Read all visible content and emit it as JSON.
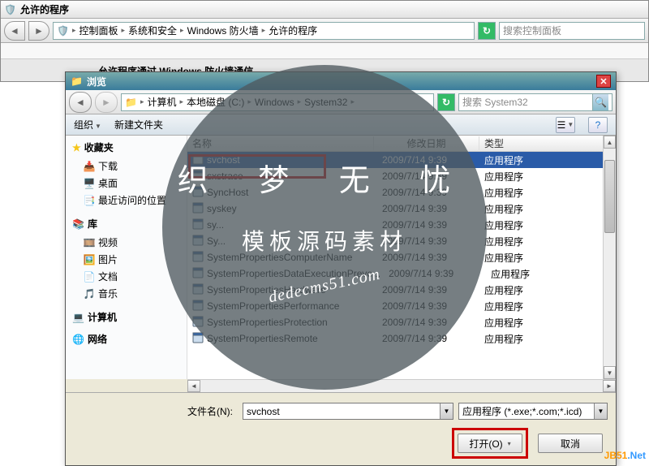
{
  "outer_window": {
    "title": "允许的程序",
    "breadcrumb": [
      "控制面板",
      "系统和安全",
      "Windows 防火墙",
      "允许的程序"
    ],
    "search_placeholder": "搜索控制面板",
    "subtitle": "允许程序通过 Windows 防火墙通信"
  },
  "dialog": {
    "title": "浏览",
    "breadcrumb": [
      "计算机",
      "本地磁盘 (C:)",
      "Windows",
      "System32"
    ],
    "search_placeholder": "搜索 System32",
    "toolbar": {
      "organize": "组织",
      "new_folder": "新建文件夹"
    },
    "sidebar": {
      "favorites": {
        "label": "收藏夹",
        "items": [
          "下载",
          "桌面",
          "最近访问的位置"
        ]
      },
      "libraries": {
        "label": "库",
        "items": [
          "视频",
          "图片",
          "文档",
          "音乐"
        ]
      },
      "computer": "计算机",
      "network": "网络"
    },
    "columns": {
      "name": "名称",
      "date": "修改日期",
      "type": "类型"
    },
    "files": [
      {
        "name": "svchost",
        "date": "2009/7/14 9:39",
        "type": "应用程序",
        "selected": true
      },
      {
        "name": "sxstrace",
        "date": "2009/7/14 9:39",
        "type": "应用程序"
      },
      {
        "name": "SyncHost",
        "date": "2009/7/14 9:39",
        "type": "应用程序"
      },
      {
        "name": "syskey",
        "date": "2009/7/14 9:39",
        "type": "应用程序"
      },
      {
        "name": "sy...",
        "date": "2009/7/14 9:39",
        "type": "应用程序"
      },
      {
        "name": "Sy...",
        "date": "2009/7/14 9:39",
        "type": "应用程序"
      },
      {
        "name": "SystemPropertiesComputerName",
        "date": "2009/7/14 9:39",
        "type": "应用程序"
      },
      {
        "name": "SystemPropertiesDataExecutionPreve...",
        "date": "2009/7/14 9:39",
        "type": "应用程序"
      },
      {
        "name": "SystemPropertiesHardware",
        "date": "2009/7/14 9:39",
        "type": "应用程序"
      },
      {
        "name": "SystemPropertiesPerformance",
        "date": "2009/7/14 9:39",
        "type": "应用程序"
      },
      {
        "name": "SystemPropertiesProtection",
        "date": "2009/7/14 9:39",
        "type": "应用程序"
      },
      {
        "name": "SystemPropertiesRemote",
        "date": "2009/7/14 9:39",
        "type": "应用程序"
      }
    ],
    "filename_label": "文件名(N):",
    "filename_value": "svchost",
    "filter_value": "应用程序 (*.exe;*.com;*.icd)",
    "open_btn": "打开(O)",
    "cancel_btn": "取消"
  },
  "watermark": {
    "line1": "织 梦 无 忧",
    "line2": "模板源码素材",
    "url": "dedecms51.com"
  },
  "footer": {
    "text": "JB51",
    "suffix": ".Net"
  }
}
